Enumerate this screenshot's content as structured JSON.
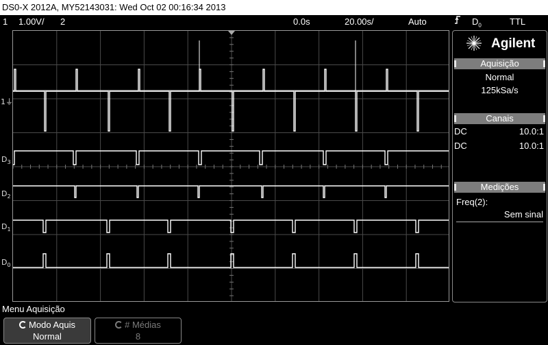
{
  "title_bar": "DS0-X 2012A, MY52143031: Wed Oct 02 00:16:34 2013",
  "status": {
    "channel": "1",
    "volts_div": "1.00V/",
    "channel2": "2",
    "time_offset": "0.0s",
    "time_div": "20.00s/",
    "trigger_mode": "Auto",
    "trigger_source": "D",
    "trigger_source_sub": "0",
    "trigger_level": "TTL"
  },
  "brand": "Agilent",
  "acquisition": {
    "header": "Aquisição",
    "mode": "Normal",
    "rate": "125kSa/s"
  },
  "channels": {
    "header": "Canais",
    "rows": [
      {
        "coupling": "DC",
        "probe": "10.0:1"
      },
      {
        "coupling": "DC",
        "probe": "10.0:1"
      }
    ]
  },
  "measurements": {
    "header": "Medições",
    "label": "Freq(2):",
    "value": "Sem sinal"
  },
  "digital_labels": {
    "d3": {
      "main": "D",
      "sub": "3"
    },
    "d2": {
      "main": "D",
      "sub": "2"
    },
    "d1": {
      "main": "D",
      "sub": "1"
    },
    "d0": {
      "main": "D",
      "sub": "0"
    }
  },
  "ground_marker": "1",
  "menu": {
    "title": "Menu Aquisição",
    "softkeys": [
      {
        "label": "Modo Aquis",
        "value": "Normal"
      },
      {
        "label": "# Médias",
        "value": "8"
      }
    ]
  },
  "colors": {
    "trace": "#ffffff",
    "grid": "#4a4a4a",
    "panel_header": "#7d7d7d"
  }
}
